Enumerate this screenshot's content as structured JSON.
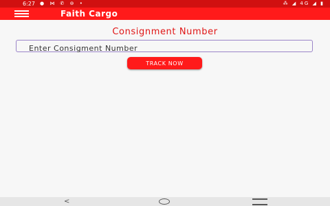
{
  "status_bar": {
    "time": "6:27",
    "left_icons": "● ⋈ ✆ ⊚ •",
    "right_icons": "⁂ ◢ 4G ◢ ▮"
  },
  "app_bar": {
    "title": "Faith Cargo",
    "menu_icon": "hamburger-menu-icon"
  },
  "main": {
    "heading": "Consignment Number",
    "input_placeholder": "Enter Consigment Number",
    "input_value": "",
    "track_button_label": "TRACK NOW"
  },
  "nav_bar": {
    "back_glyph": "<",
    "home_icon": "home-circle-icon",
    "recents_icon": "recents-icon"
  },
  "colors": {
    "primary": "#ff1a1a",
    "status_bar": "#d01010",
    "heading_text": "#e01515",
    "input_border": "#9a84c8"
  }
}
